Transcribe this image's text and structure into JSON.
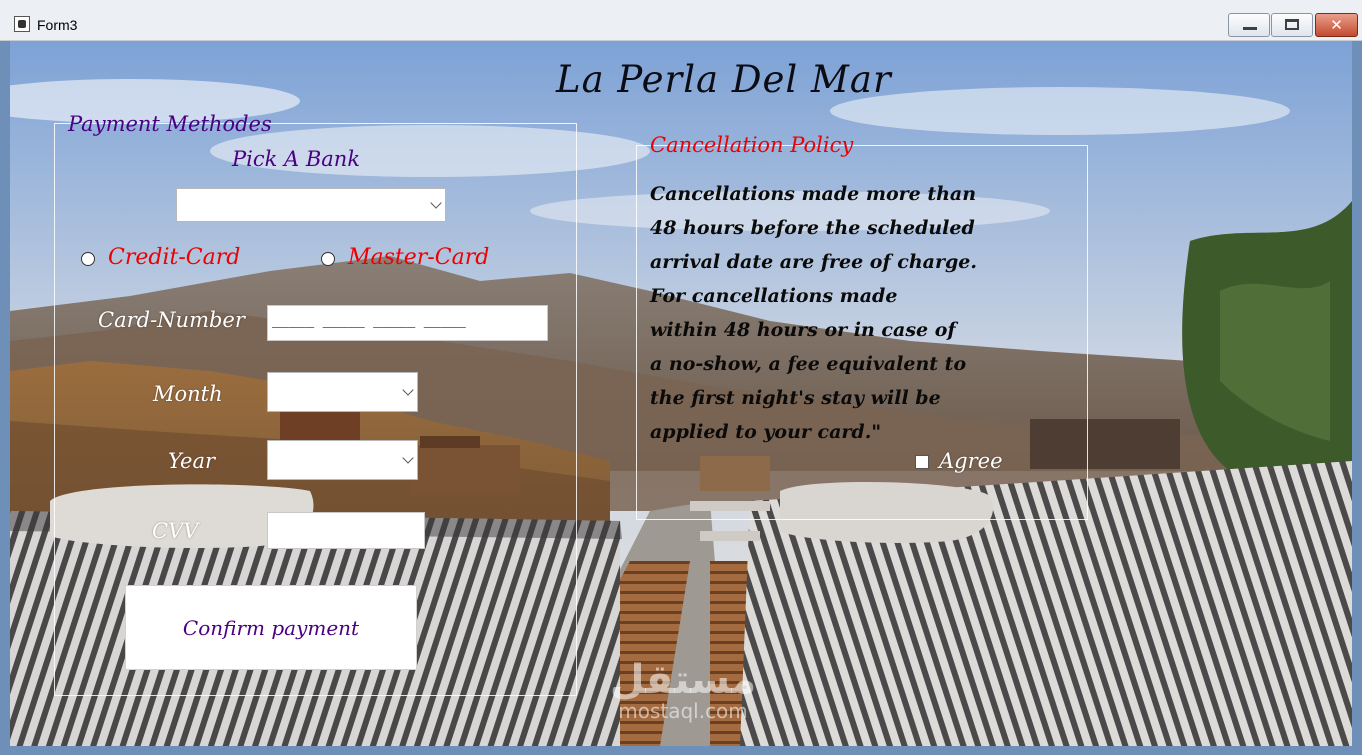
{
  "window": {
    "title": "Form3",
    "close_symbol": "✕"
  },
  "header": {
    "title": "La Perla Del Mar"
  },
  "payment": {
    "group_title": "Payment Methodes",
    "bank_label": "Pick A Bank",
    "bank_selected": "",
    "option_credit": "Credit-Card",
    "option_master": "Master-Card",
    "card_number_label": "Card-Number",
    "card_number_value": "_____ _____ _____ _____",
    "month_label": "Month",
    "month_selected": "",
    "year_label": "Year",
    "year_selected": "",
    "cvv_label": "CVV",
    "cvv_value": "",
    "confirm_label": "Confirm payment"
  },
  "policy": {
    "title": "Cancellation Policy",
    "lines": [
      "Cancellations made more than",
      "48 hours before the scheduled",
      "arrival date are free of charge.",
      "For cancellations made",
      "within 48 hours or in case of",
      "a no-show, a fee equivalent to",
      "the first night's stay will be",
      "applied to your card.\""
    ],
    "agree_label": "Agree"
  },
  "watermark": {
    "arabic": "مستقل",
    "latin": "mostaql.com"
  },
  "colors": {
    "label_purple": "#4b0082",
    "label_red": "#ee0000",
    "close_red": "#c34a2f"
  }
}
